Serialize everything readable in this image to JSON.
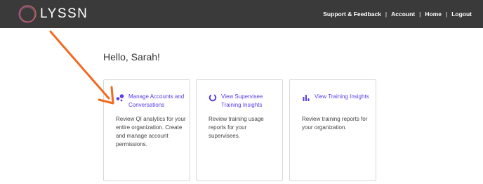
{
  "header": {
    "brand": "LYSSN",
    "nav": [
      {
        "label": "Support & Feedback"
      },
      {
        "label": "Account"
      },
      {
        "label": "Home"
      },
      {
        "label": "Logout"
      }
    ],
    "separator": "|"
  },
  "main": {
    "greeting": "Hello, Sarah!",
    "cards": [
      {
        "title": "Manage Accounts and Conversations",
        "description": "Review QI analytics for your entire organization. Create and manage account permissions.",
        "icon": "accounts-icon"
      },
      {
        "title": "View Supervisee Training Insights",
        "description": "Review training usage reports for your supervisees.",
        "icon": "progress-ring-icon"
      },
      {
        "title": "View Training Insights",
        "description": "Review training reports for your organization.",
        "icon": "bar-chart-icon"
      }
    ]
  },
  "colors": {
    "topbar": "#3a3a3a",
    "link": "#5b3ce6",
    "arrow": "#f26a21"
  }
}
